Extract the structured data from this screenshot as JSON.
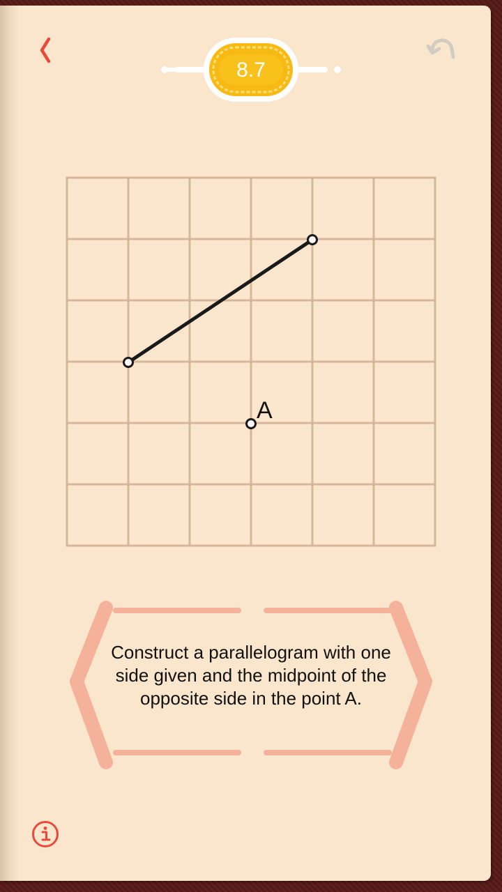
{
  "header": {
    "back_icon": "chevron-left-icon",
    "undo_icon": "undo-icon",
    "level": "8.7"
  },
  "board": {
    "point_label": "A"
  },
  "task": {
    "text": "Construct a parallelogram with one side given and the midpoint of the opposite side in the point A."
  },
  "footer": {
    "info_icon": "info-icon"
  },
  "colors": {
    "page": "#fae6cc",
    "grid_line": "#d6b69a",
    "accent_red": "#e8493a",
    "badge_gold": "#f7b913",
    "banner": "#f5b29b",
    "undo_gray": "#d2cbc2",
    "book_cover": "#5a1e1b"
  }
}
